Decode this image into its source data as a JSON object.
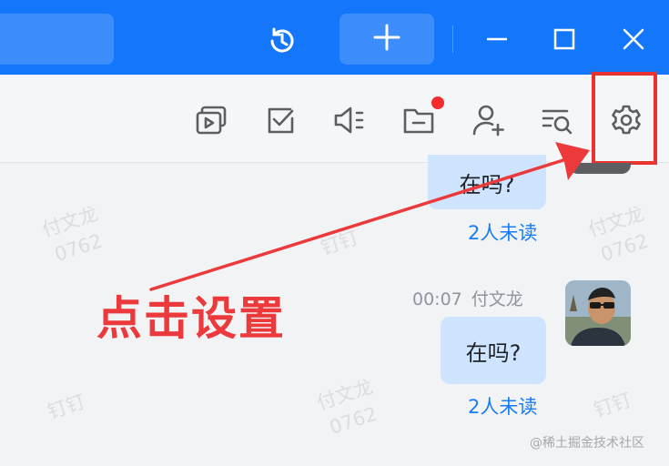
{
  "colors": {
    "titlebar": "#1477fb",
    "accent": "#1a7cf5",
    "annotation": "#e8332f",
    "bubble": "#cfe5ff"
  },
  "titlebar": {
    "icons": [
      "history-icon",
      "plus-icon",
      "minimize-icon",
      "maximize-icon",
      "close-icon"
    ]
  },
  "toolbar": {
    "icons": [
      "screen-share-icon",
      "todo-icon",
      "announcement-icon",
      "files-icon",
      "add-member-icon",
      "search-history-icon",
      "settings-icon"
    ]
  },
  "messages": [
    {
      "text": "在吗?",
      "read_status": "2人未读"
    },
    {
      "time": "00:07",
      "sender": "付文龙",
      "text": "在吗?",
      "read_status": "2人未读"
    }
  ],
  "watermarks": [
    {
      "line1": "付文龙",
      "line2": "0762"
    },
    {
      "line1": "钉钉",
      "line2": ""
    },
    {
      "line1": "付文龙",
      "line2": "0762"
    },
    {
      "line1": "钉钉",
      "line2": ""
    },
    {
      "line1": "付文龙",
      "line2": "0762"
    },
    {
      "line1": "钉钉",
      "line2": ""
    }
  ],
  "annotation": {
    "text": "点击设置"
  },
  "credit": "@稀土掘金技术社区"
}
